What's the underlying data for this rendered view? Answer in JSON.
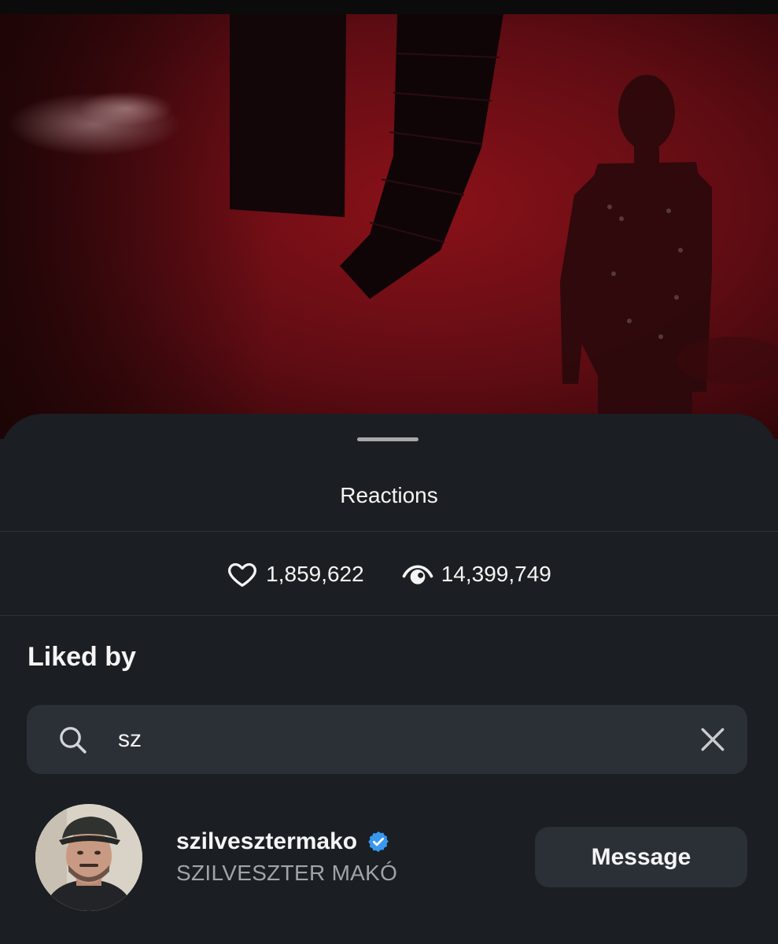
{
  "sheet": {
    "title": "Reactions"
  },
  "stats": {
    "likes": "1,859,622",
    "views": "14,399,749"
  },
  "liked_by": {
    "title": "Liked by"
  },
  "search": {
    "value": "sz"
  },
  "users": [
    {
      "username": "szilvesztermako",
      "full_name": "SZILVESZTER MAKÓ",
      "verified": true,
      "button_label": "Message"
    }
  ],
  "colors": {
    "sheet_background": "#1b1e22",
    "field_background": "#2b2f36",
    "verified_badge": "#3897f0",
    "media_red": "#5a0d12"
  },
  "icons": {
    "likes": "heart-outline-icon",
    "views": "eye-icon",
    "search": "search-icon",
    "clear": "close-icon",
    "verified": "verified-badge-icon"
  }
}
